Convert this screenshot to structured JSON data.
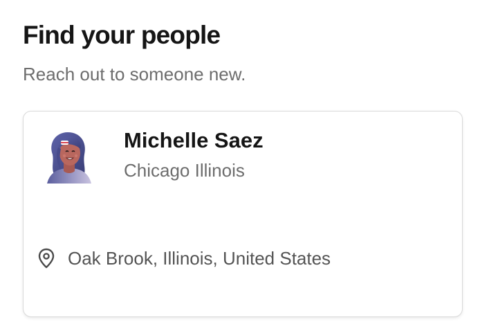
{
  "header": {
    "title": "Find your people",
    "subtitle": "Reach out to someone new."
  },
  "person_card": {
    "name": "Michelle Saez",
    "city": "Chicago Illinois",
    "location": "Oak Brook, Illinois, United States",
    "avatar_icon": "woman-avatar-illustration",
    "location_icon": "map-pin-icon"
  },
  "colors": {
    "title": "#151515",
    "muted_text": "#6d6d6d",
    "card_border": "#d9d9d9",
    "avatar_hair": "#4a4f8f",
    "avatar_skin": "#b9675e"
  }
}
